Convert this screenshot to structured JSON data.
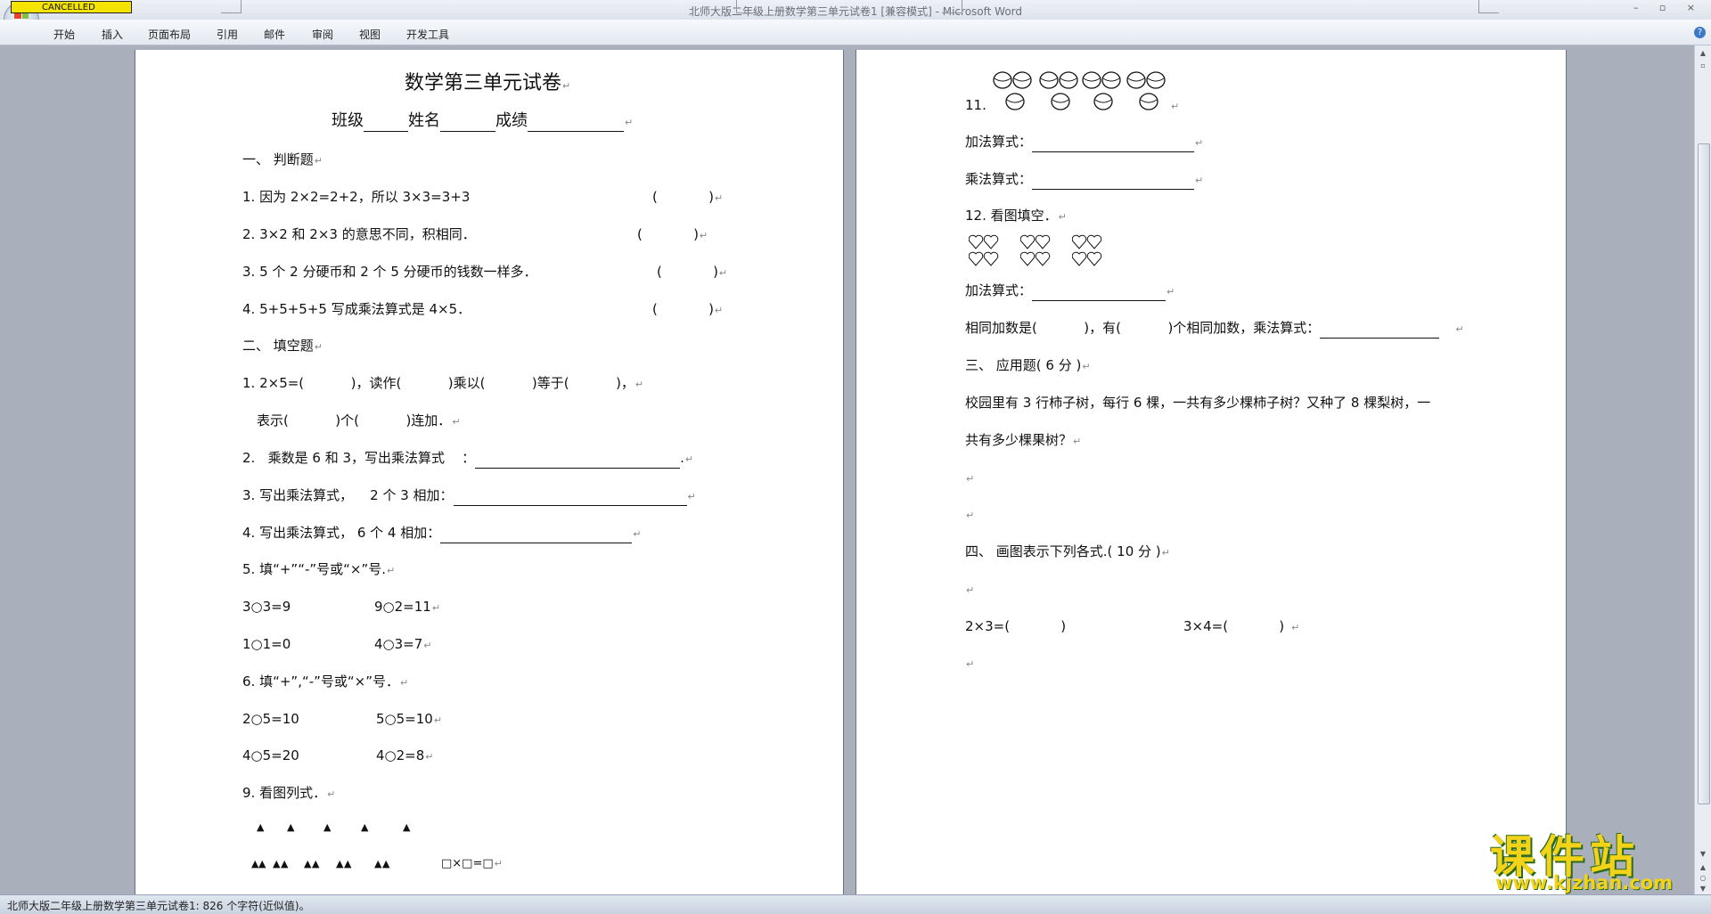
{
  "window": {
    "title": "北师大版二年级上册数学第三单元试卷1 [兼容模式] - Microsoft Word",
    "cancelled_badge": "CANCELLED",
    "controls": "– ▫ ×"
  },
  "ribbon": {
    "tabs": [
      "开始",
      "插入",
      "页面布局",
      "引用",
      "邮件",
      "审阅",
      "视图",
      "开发工具"
    ],
    "help_label": "?"
  },
  "page1": {
    "title": "数学第三单元试卷",
    "info": {
      "class_label": "班级",
      "name_label": "姓名",
      "score_label": "成绩"
    },
    "section1": "一、 判断题",
    "j1": "1. 因为 2×2=2+2，所以 3×3=3+3",
    "j1_paren": "(            )",
    "j2": "2. 3×2 和 2×3 的意思不同，积相同．",
    "j2_paren": "(            )",
    "j3": "3. 5 个 2 分硬币和 2 个 5 分硬币的钱数一样多．",
    "j3_paren": "(            )",
    "j4": "4. 5+5+5+5 写成乘法算式是 4×5．",
    "j4_paren": "(            )",
    "section2": "二、 填空题",
    "f1a": "1. 2×5=(           )，读作(           )乘以(           )等于(           )，",
    "f1b": "表示(           )个(           )连加．",
    "f2": "2.   乘数是 6 和 3，写出乘法算式    ：",
    "f2_end": ".",
    "f3": "3. 写出乘法算式，    2 个 3 相加：",
    "f4": "4. 写出乘法算式， 6 个 4 相加：",
    "f5": "5. 填“+”“-”号或“×”号.",
    "f5_a1": "3○3=9",
    "f5_a2": "9○2=11",
    "f5_b1": "1○1=0",
    "f5_b2": "4○3=7",
    "f6": "6. 填“+”,“-”号或“×”号．",
    "f6_a1": "2○5=10",
    "f6_a2": "5○5=10",
    "f6_b1": "4○5=20",
    "f6_b2": "4○2=8",
    "f9": "9. 看图列式．",
    "f9_triangle": "▲",
    "f9_formula": "□×□=□"
  },
  "page2": {
    "q11": "11.",
    "q11_add": "加法算式：",
    "q11_mul": "乘法算式：",
    "q12": "12. 看图填空．",
    "q12_add": "加法算式：",
    "q12_same": "相同加数是(           )，有(           )个相同加数，乘法算式：",
    "section3": "三、 应用题( 6 分 )",
    "app_line1": "校园里有 3 行柿子树，每行 6 棵，一共有多少棵柿子树？又种了 8 棵梨树，一",
    "app_line2": "共有多少棵果树？",
    "section4": "四、 画图表示下列各式.( 10 分 )",
    "draw1": "2×3=(            )",
    "draw2": "3×4=(            )"
  },
  "paragraph_mark": "↵",
  "status": {
    "text": "北师大版二年级上册数学第三单元试卷1: 826 个字符(近似值)。"
  },
  "watermark": {
    "big": "课件站",
    "url": "www.kjzhan.com"
  },
  "colors": {
    "ribbon_bg": "#e3e9f1",
    "canvas": "#a9b0bb",
    "logo_yellow": "#f3d21a",
    "logo_green": "#2a6a1a"
  }
}
